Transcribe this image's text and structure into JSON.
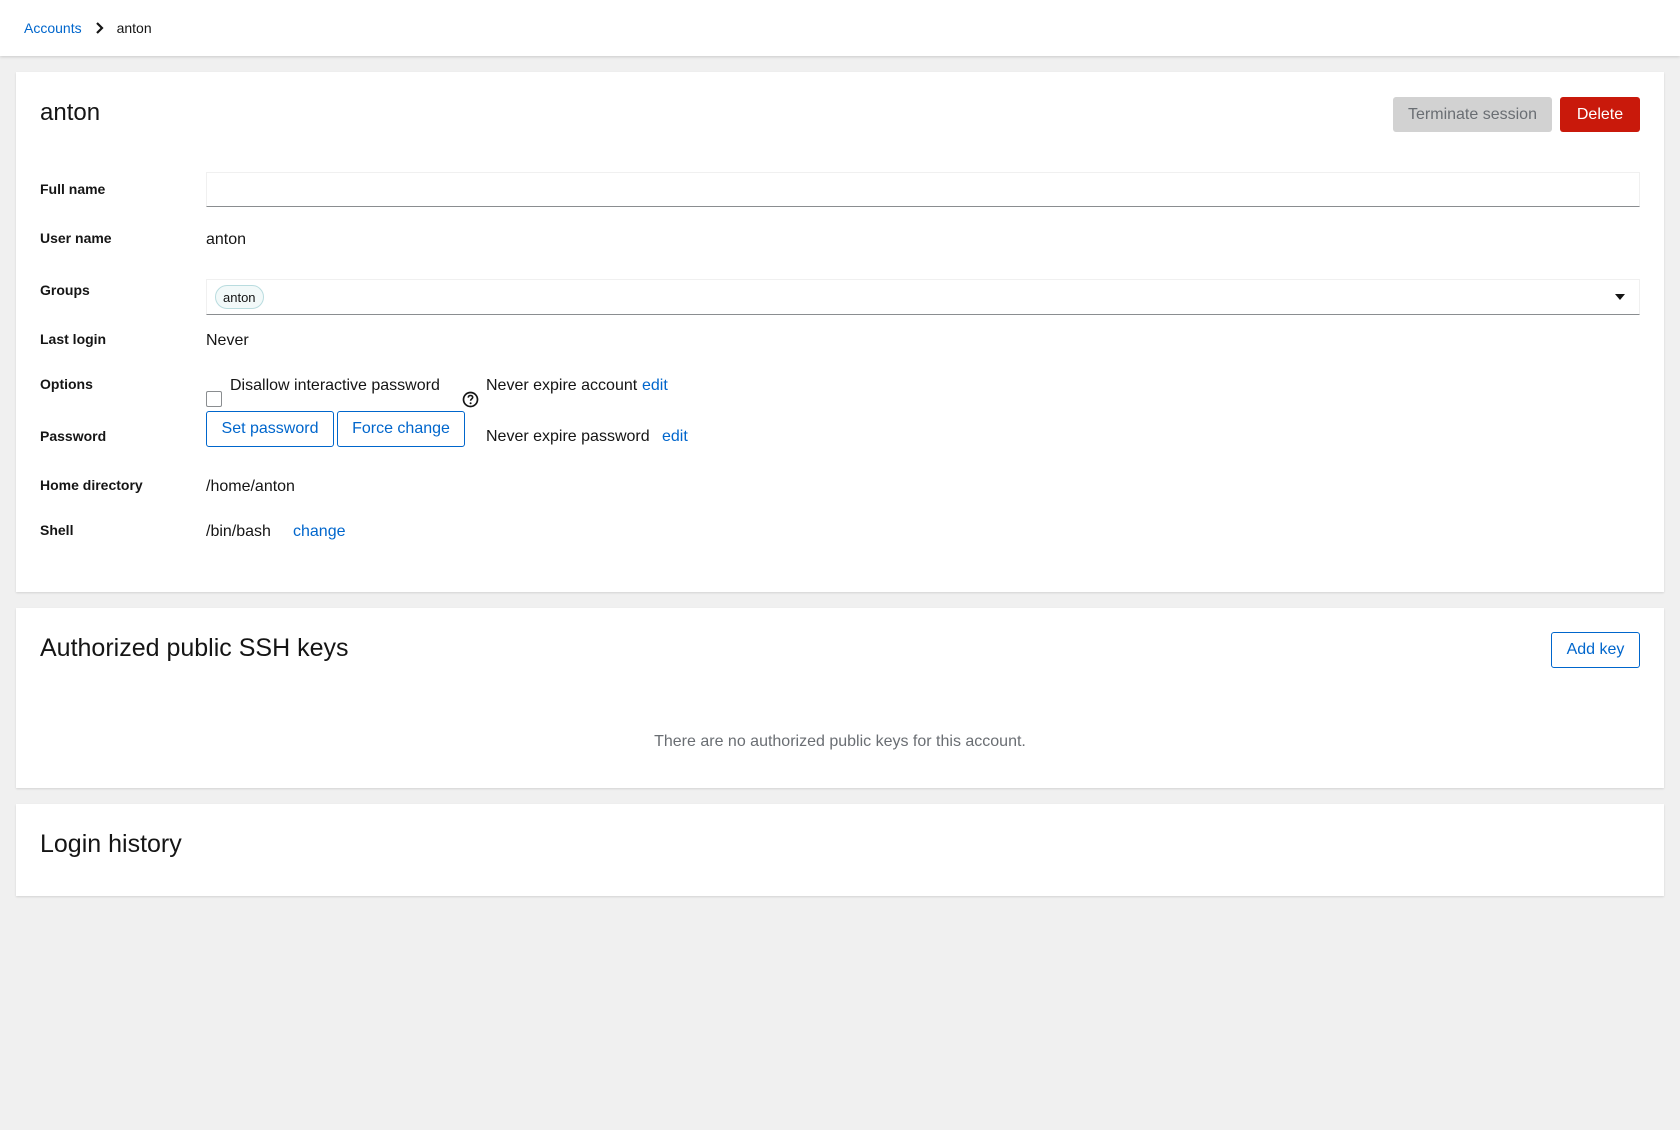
{
  "breadcrumb": {
    "parent": "Accounts",
    "current": "anton"
  },
  "account": {
    "title": "anton",
    "terminate_label": "Terminate session",
    "delete_label": "Delete",
    "full_name_label": "Full name",
    "full_name_value": "",
    "user_name_label": "User name",
    "user_name_value": "anton",
    "groups_label": "Groups",
    "groups": [
      "anton"
    ],
    "last_login_label": "Last login",
    "last_login_value": "Never",
    "options_label": "Options",
    "disallow_password_label": "Disallow interactive password",
    "disallow_password_checked": false,
    "account_expiry_text": "Never expire account",
    "account_expiry_edit": "edit",
    "password_label": "Password",
    "set_password_label": "Set password",
    "force_change_label": "Force change",
    "password_expiry_text": "Never expire password",
    "password_expiry_edit": "edit",
    "home_label": "Home directory",
    "home_value": "/home/anton",
    "shell_label": "Shell",
    "shell_value": "/bin/bash",
    "shell_change": "change"
  },
  "ssh": {
    "title": "Authorized public SSH keys",
    "add_key_label": "Add key",
    "empty_message": "There are no authorized public keys for this account."
  },
  "login_history": {
    "title": "Login history"
  },
  "icons": {
    "breadcrumb_separator": "chevron-right-icon",
    "groups_toggle": "caret-down-icon",
    "options_help": "help-icon"
  },
  "colors": {
    "link": "#0066cc",
    "danger": "#c9190b",
    "disabled_bg": "#d2d2d2",
    "page_bg": "#f0f0f0"
  }
}
